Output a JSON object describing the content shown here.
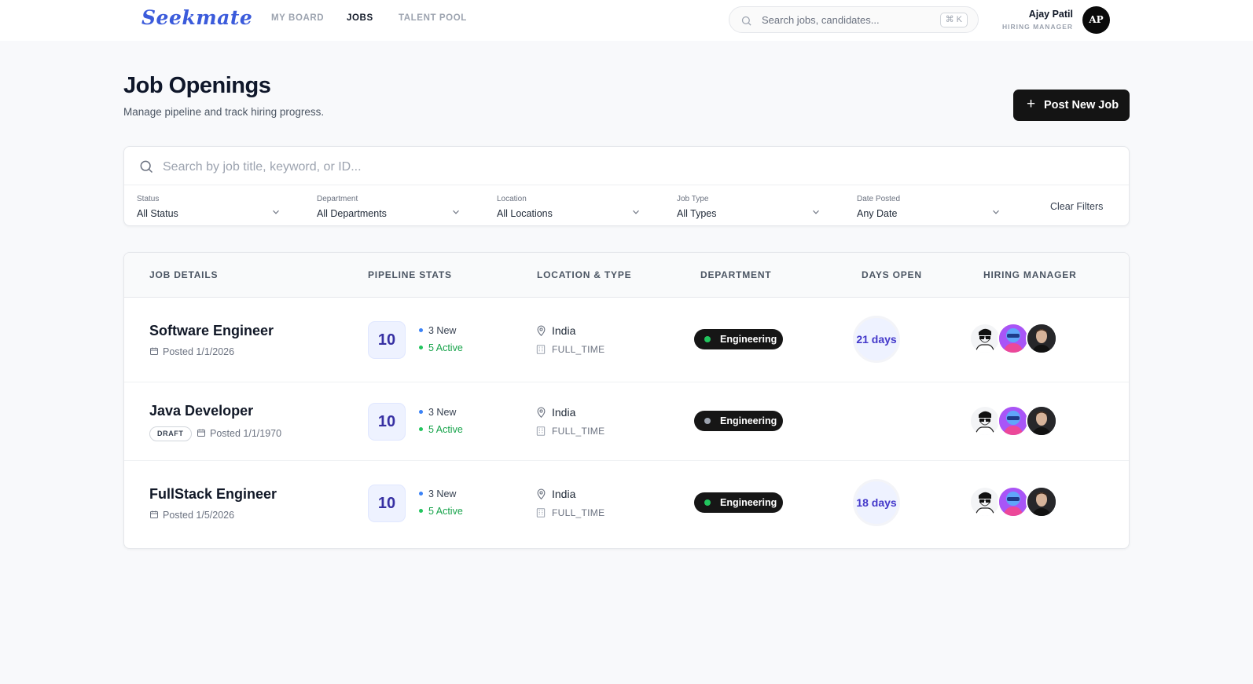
{
  "header": {
    "logo": "Seekmate",
    "nav": [
      "MY BOARD",
      "JOBS",
      "TALENT POOL"
    ],
    "active_nav": "JOBS",
    "search_placeholder": "Search jobs, candidates...",
    "search_shortcut": "⌘ K",
    "user": {
      "name": "Ajay Patil",
      "role": "HIRING MANAGER",
      "initials": "AP"
    }
  },
  "page": {
    "title": "Job Openings",
    "subtitle": "Manage pipeline and track hiring progress.",
    "post_button": "Post New Job"
  },
  "filters": {
    "search_placeholder": "Search by job title, keyword, or ID...",
    "groups": [
      {
        "label": "Status",
        "value": "All Status"
      },
      {
        "label": "Department",
        "value": "All Departments"
      },
      {
        "label": "Location",
        "value": "All Locations"
      },
      {
        "label": "Job Type",
        "value": "All Types"
      },
      {
        "label": "Date Posted",
        "value": "Any Date"
      }
    ],
    "clear_label": "Clear Filters"
  },
  "table": {
    "headers": [
      "JOB DETAILS",
      "PIPELINE STATS",
      "LOCATION & TYPE",
      "DEPARTMENT",
      "DAYS OPEN",
      "HIRING MANAGER"
    ],
    "rows": [
      {
        "title": "Software Engineer",
        "posted": "Posted 1/1/2026",
        "badge": "",
        "pipeline_total": "10",
        "pipeline_new": "3 New",
        "pipeline_active": "5 Active",
        "location": "India",
        "job_type": "FULL_TIME",
        "department": "Engineering",
        "department_status_color": "#22c55e",
        "days_open": "21 days"
      },
      {
        "title": "Java Developer",
        "posted": "Posted 1/1/1970",
        "badge": "DRAFT",
        "pipeline_total": "10",
        "pipeline_new": "3 New",
        "pipeline_active": "5 Active",
        "location": "India",
        "job_type": "FULL_TIME",
        "department": "Engineering",
        "department_status_color": "#9ca3af",
        "days_open": ""
      },
      {
        "title": "FullStack Engineer",
        "posted": "Posted 1/5/2026",
        "badge": "",
        "pipeline_total": "10",
        "pipeline_new": "3 New",
        "pipeline_active": "5 Active",
        "location": "India",
        "job_type": "FULL_TIME",
        "department": "Engineering",
        "department_status_color": "#22c55e",
        "days_open": "18 days"
      }
    ]
  },
  "colors": {
    "brand": "#3b5bdb",
    "primary_button": "#141414",
    "new_dot": "#3b82f6",
    "active_text": "#16a34a",
    "days_text": "#4338ca"
  },
  "icons": {
    "search": "search-icon",
    "chevron": "chevron-down-icon",
    "calendar": "calendar-icon",
    "location": "map-pin-icon",
    "building": "building-icon",
    "plus": "plus-icon"
  }
}
